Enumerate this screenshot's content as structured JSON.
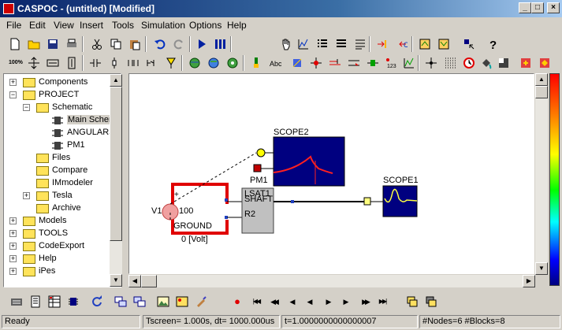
{
  "window": {
    "title": "CASPOC - (untitled) [Modified]",
    "minimize": "_",
    "maximize": "□",
    "close": "×"
  },
  "menu": [
    "File",
    "Edit",
    "View",
    "Insert",
    "Tools",
    "Simulation",
    "Options",
    "Help"
  ],
  "toolbar1_icons": [
    "new-icon",
    "open-icon",
    "save-icon",
    "print-icon",
    "cut-icon",
    "copy-icon",
    "paste-icon",
    "undo-icon",
    "redo-icon",
    "step-icon",
    "run-icon",
    "hand-icon",
    "graph-icon",
    "list-icon",
    "list2-icon",
    "list3-icon",
    "connect-icon",
    "disconnect-icon",
    "export-icon",
    "import-icon",
    "cursor-icon",
    "help-icon"
  ],
  "toolbar1_text": {
    "zoom": "100%"
  },
  "tree": [
    {
      "label": "Components",
      "level": 0,
      "expander": "+",
      "kind": "folder"
    },
    {
      "label": "PROJECT",
      "level": 0,
      "expander": "−",
      "kind": "folder"
    },
    {
      "label": "Schematic",
      "level": 1,
      "expander": "−",
      "kind": "folder"
    },
    {
      "label": "Main Scher",
      "level": 2,
      "expander": "",
      "kind": "component",
      "selected": true
    },
    {
      "label": "ANGULARS",
      "level": 2,
      "expander": "",
      "kind": "component"
    },
    {
      "label": "PM1",
      "level": 2,
      "expander": "",
      "kind": "component"
    },
    {
      "label": "Files",
      "level": 1,
      "expander": "",
      "kind": "folder"
    },
    {
      "label": "Compare",
      "level": 1,
      "expander": "",
      "kind": "folder"
    },
    {
      "label": "IMmodeler",
      "level": 1,
      "expander": "",
      "kind": "folder"
    },
    {
      "label": "Tesla",
      "level": 1,
      "expander": "+",
      "kind": "folder"
    },
    {
      "label": "Archive",
      "level": 1,
      "expander": "",
      "kind": "folder"
    },
    {
      "label": "Models",
      "level": 0,
      "expander": "+",
      "kind": "folder"
    },
    {
      "label": "TOOLS",
      "level": 0,
      "expander": "+",
      "kind": "folder"
    },
    {
      "label": "CodeExport",
      "level": 0,
      "expander": "+",
      "kind": "folder"
    },
    {
      "label": "Help",
      "level": 0,
      "expander": "+",
      "kind": "folder"
    },
    {
      "label": "iPes",
      "level": 0,
      "expander": "+",
      "kind": "folder"
    }
  ],
  "schematic": {
    "scope2_label": "SCOPE2",
    "scope1_label": "SCOPE1",
    "pm1_label": "PM1",
    "block_line1": "LSAT1",
    "block_line2": "SHAFT",
    "block_r2": "R2",
    "source_label": "V1",
    "source_value": "100",
    "plus_sign": "+",
    "ground_label": "GROUND",
    "voltage_readout": "0   [Volt]"
  },
  "playback": {
    "record": "●",
    "to_start": "|◀◀",
    "fast_back": "◀◀",
    "step_back": "◀",
    "back": "◀",
    "play": "▶",
    "step_fwd": "▶",
    "fast_fwd": "▶▶",
    "to_end": "▶▶|"
  },
  "status": {
    "ready": "Ready",
    "tscreen": "Tscreen= 1.000s, dt= 1000.000us",
    "time": "t=1.0000000000000007",
    "counts": "#Nodes=6 #Blocks=8"
  },
  "colors": {
    "title_start": "#0a246a",
    "wire_red": "#e00000",
    "scope_bg": "#000080",
    "scope_trace_red": "#ff2020",
    "scope_trace_yellow": "#ffff40"
  }
}
